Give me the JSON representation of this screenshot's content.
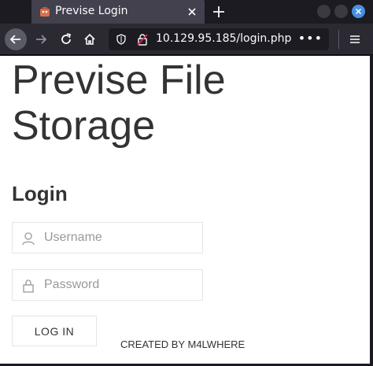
{
  "browser": {
    "tab": {
      "title": "Previse Login",
      "favicon": "previse-favicon-icon"
    },
    "url": "10.129.95.185/login.php",
    "page_actions": "•••",
    "colors": {
      "chrome_dark": "#1c1b22",
      "toolbar": "#2b2a33",
      "tab_active": "#42414d",
      "close_accent": "#4a90e2"
    }
  },
  "page": {
    "site_title": "Previse File Storage",
    "login_heading": "Login",
    "username_placeholder": "Username",
    "password_placeholder": "Password",
    "login_button": "LOG IN",
    "credit": "CREATED BY M4LWHERE"
  }
}
